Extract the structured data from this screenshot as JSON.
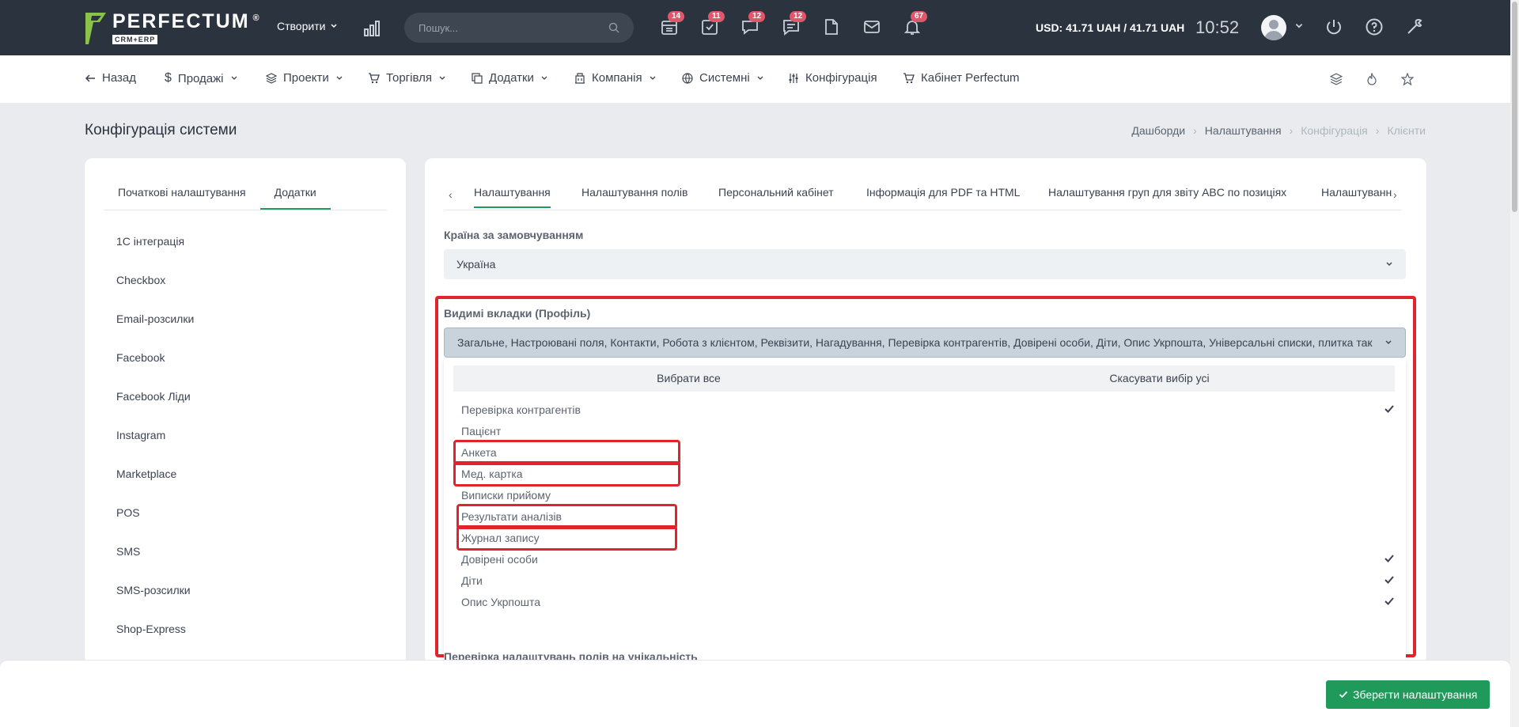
{
  "header": {
    "logo_title": "PERFECTUM",
    "logo_reg": "®",
    "logo_sub": "CRM+ERP",
    "create_label": "Створити",
    "search_placeholder": "Пошук...",
    "badges": {
      "calendar": "14",
      "tasks": "11",
      "chat": "12",
      "messages": "12",
      "notifications": "67"
    },
    "currency": "USD: 41.71 UAH / 41.71 UAH",
    "time": "10:52"
  },
  "menu": {
    "back": "Назад",
    "sales": "Продажі",
    "projects": "Проекти",
    "trade": "Торгівля",
    "addons": "Додатки",
    "company": "Компанія",
    "system": "Системні",
    "config": "Конфігурація",
    "cabinet": "Кабінет Perfectum"
  },
  "page": {
    "title": "Конфігурація системи",
    "breadcrumb": [
      "Дашборди",
      "Налаштування",
      "Конфігурація",
      "Клієнти"
    ]
  },
  "left_tabs": [
    "Початкові налаштування",
    "Додатки"
  ],
  "left_items": [
    "1С інтеграція",
    "Checkbox",
    "Email-розсилки",
    "Facebook",
    "Facebook Ліди",
    "Instagram",
    "Marketplace",
    "POS",
    "SMS",
    "SMS-розсилки",
    "Shop-Express"
  ],
  "main_tabs": [
    "Налаштування",
    "Налаштування полів",
    "Персональний кабінет",
    "Інформація для PDF та HTML",
    "Налаштування груп для звіту ABC по позиціях",
    "Налаштування"
  ],
  "form": {
    "country_label": "Країна за замовчуванням",
    "country_value": "Україна",
    "tabs_label": "Видимі вкладки (Профіль)",
    "tabs_value": "Загальне, Настроювані поля, Контакти, Робота з клієнтом, Реквізити, Нагадування, Перевірка контрагентів, Довірені особи, Діти, Опис Укрпошта, Універсальні списки, плитка так",
    "select_all": "Вибрати все",
    "deselect_all": "Скасувати вибір усі",
    "options": [
      {
        "label": "Перевірка контрагентів",
        "checked": true
      },
      {
        "label": "Пацієнт",
        "checked": false
      },
      {
        "label": "Анкета",
        "checked": false
      },
      {
        "label": "Мед. картка",
        "checked": false
      },
      {
        "label": "Виписки прийому",
        "checked": false
      },
      {
        "label": "Результати аналізів",
        "checked": false
      },
      {
        "label": "Журнал запису",
        "checked": false
      },
      {
        "label": "Довірені особи",
        "checked": true
      },
      {
        "label": "Діти",
        "checked": true
      },
      {
        "label": "Опис Укрпошта",
        "checked": true
      }
    ],
    "next_label": "Перевірка налаштувань полів на унікальність"
  },
  "footer": {
    "save_label": "Зберегти налаштування"
  },
  "colors": {
    "accent": "#1f9a5a",
    "header": "#2b333e",
    "highlight": "#e1242c",
    "badge": "#e0566b"
  }
}
